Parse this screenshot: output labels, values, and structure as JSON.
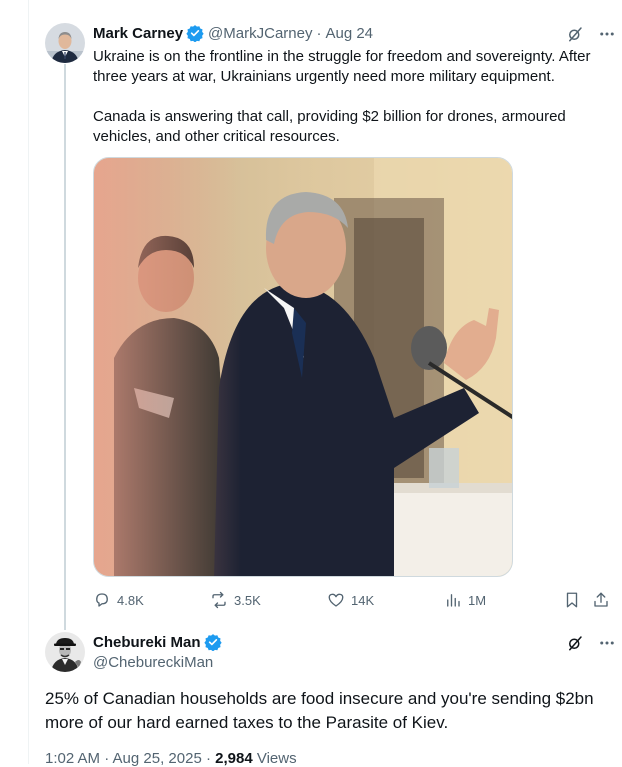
{
  "colors": {
    "accent": "#1d9bf0",
    "text": "#0f1419",
    "muted": "#536471",
    "border": "#cfd9de"
  },
  "original_tweet": {
    "author": {
      "name": "Mark Carney",
      "handle": "@MarkJCarney",
      "verified": true
    },
    "separator": "·",
    "date": "Aug 24",
    "paragraphs": [
      "Ukraine is on the frontline in the struggle for freedom and sovereignty. After three years at war, Ukrainians urgently need more military equipment.",
      "Canada is answering that call, providing $2 billion for drones, armoured vehicles, and other critical resources."
    ],
    "media": {
      "type": "photo"
    },
    "actions": {
      "replies": "4.8K",
      "reposts": "3.5K",
      "likes": "14K",
      "views": "1M"
    },
    "icons": [
      "grok-icon",
      "more-icon",
      "reply-icon",
      "repost-icon",
      "like-icon",
      "views-icon",
      "bookmark-icon",
      "share-icon"
    ]
  },
  "reply": {
    "author": {
      "name": "Chebureki Man",
      "handle": "@ChebureckiMan",
      "verified": true
    },
    "text": "25% of Canadian households are food insecure and you're sending $2bn more of our hard earned taxes to the Parasite of Kiev.",
    "timestamp": "1:02 AM · Aug 25, 2025 ·",
    "views_count": "2,984",
    "views_label": "Views"
  }
}
